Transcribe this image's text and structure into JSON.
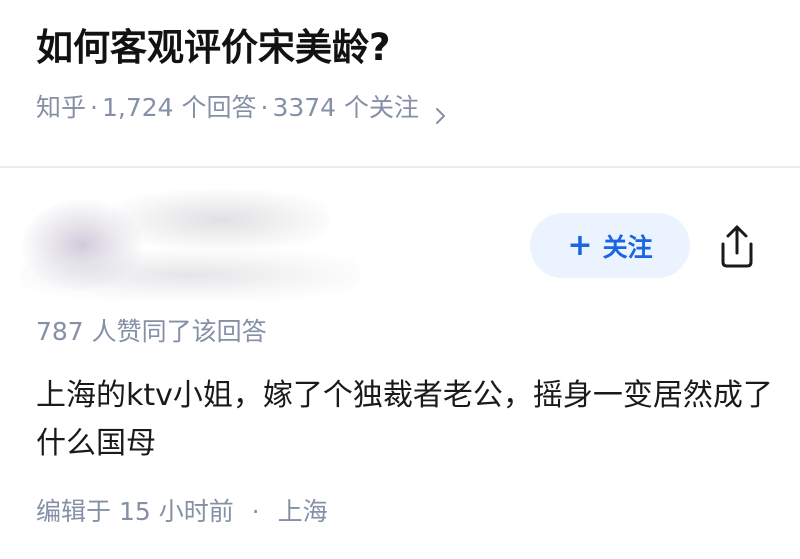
{
  "question": {
    "title": "如何客观评价宋美龄?",
    "meta": {
      "source": "知乎",
      "answers": "1,724 个回答",
      "followers": "3374 个关注",
      "separator": "·",
      "chevron_icon": "chevron-right-icon"
    }
  },
  "answer": {
    "follow_button": {
      "plus": "+",
      "label": "关注"
    },
    "share_icon": "share-icon",
    "vote_text": "787 人赞同了该回答",
    "content": "上海的ktv小姐，嫁了个独裁者老公，摇身一变居然成了什么国母",
    "footer": {
      "edited": "编辑于 15 小时前",
      "separator": "·",
      "location": "上海"
    }
  },
  "colors": {
    "accent": "#1966e0",
    "follow_bg": "#ebf3fe",
    "meta_text": "#8590a6",
    "divider": "#ececec"
  }
}
